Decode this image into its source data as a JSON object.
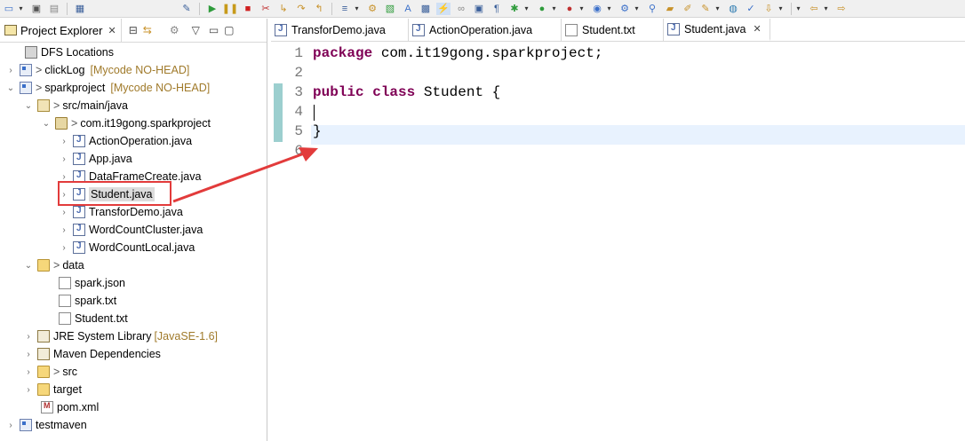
{
  "toolbar": {
    "icons": [
      "new-icon",
      "save-icon",
      "save-all-icon",
      "print-icon",
      "debug-icon",
      "run-icon",
      "stop-icon",
      "disconnect-icon",
      "step-into-icon",
      "step-over-icon",
      "step-return-icon",
      "open-console-icon",
      "coverage-icon",
      "chart-icon",
      "open-type-icon",
      "toggle-mark-icon",
      "link-icon",
      "pilcrow-icon",
      "bug-icon",
      "run-green-icon",
      "tool-icon",
      "globe-icon",
      "gear-icon",
      "search-icon",
      "folder-icon",
      "pen-icon",
      "world-icon",
      "back-icon",
      "forward-icon"
    ]
  },
  "project_explorer": {
    "tab_label": "Project Explorer",
    "tab_close": "✕",
    "tree": [
      {
        "label": "DFS Locations",
        "icon": "dfs-icon",
        "depth": 1
      },
      {
        "label": "clickLog",
        "decoration": "[Mycode NO-HEAD]",
        "icon": "project-icon",
        "depth": 0,
        "prefix": ">"
      },
      {
        "label": "sparkproject",
        "decoration": "[Mycode NO-HEAD]",
        "icon": "project-icon",
        "depth": 0,
        "prefix": ">"
      },
      {
        "label": "src/main/java",
        "icon": "package-root-icon",
        "depth": 1,
        "prefix": ">"
      },
      {
        "label": "com.it19gong.sparkproject",
        "icon": "package-icon",
        "depth": 2,
        "prefix": ">"
      },
      {
        "label": "ActionOperation.java",
        "icon": "java-file-icon",
        "depth": 3
      },
      {
        "label": "App.java",
        "icon": "java-file-icon",
        "depth": 3
      },
      {
        "label": "DataFrameCreate.java",
        "icon": "java-file-icon",
        "depth": 3
      },
      {
        "label": "Student.java",
        "icon": "java-file-icon",
        "depth": 3
      },
      {
        "label": "TransforDemo.java",
        "icon": "java-file-icon",
        "depth": 3
      },
      {
        "label": "WordCountCluster.java",
        "icon": "java-file-icon",
        "depth": 3
      },
      {
        "label": "WordCountLocal.java",
        "icon": "java-file-icon",
        "depth": 3
      },
      {
        "label": "data",
        "icon": "folder-icon",
        "depth": 1,
        "prefix": ">"
      },
      {
        "label": "spark.json",
        "icon": "file-icon",
        "depth": 2
      },
      {
        "label": "spark.txt",
        "icon": "file-icon",
        "depth": 2
      },
      {
        "label": "Student.txt",
        "icon": "file-icon",
        "depth": 2
      },
      {
        "label": "JRE System Library",
        "decoration": "[JavaSE-1.6]",
        "icon": "library-icon",
        "depth": 1
      },
      {
        "label": "Maven Dependencies",
        "icon": "library-icon",
        "depth": 1
      },
      {
        "label": "src",
        "icon": "folder-icon",
        "depth": 1,
        "prefix": ">"
      },
      {
        "label": "target",
        "icon": "folder-icon",
        "depth": 1
      },
      {
        "label": "pom.xml",
        "icon": "xml-file-icon",
        "depth": 1
      },
      {
        "label": "testmaven",
        "icon": "project-icon",
        "depth": 0
      }
    ]
  },
  "editor": {
    "tabs": [
      {
        "label": "TransforDemo.java"
      },
      {
        "label": "ActionOperation.java"
      },
      {
        "label": "Student.txt"
      },
      {
        "label": "Student.java",
        "close": "✕"
      }
    ],
    "line_numbers": [
      "1",
      "2",
      "3",
      "4",
      "5",
      "6"
    ],
    "lines": {
      "l1_kw": "package",
      "l1_rest": " com.it19gong.sparkproject;",
      "l3_kw1": "public",
      "l3_kw2": "class",
      "l3_rest": " Student {",
      "l5": "}"
    }
  },
  "colors": {
    "keyword": "#7f0055",
    "current_line": "#e8f2fe",
    "annotation_red": "#e23b3b",
    "decoration": "#a07a2a"
  }
}
